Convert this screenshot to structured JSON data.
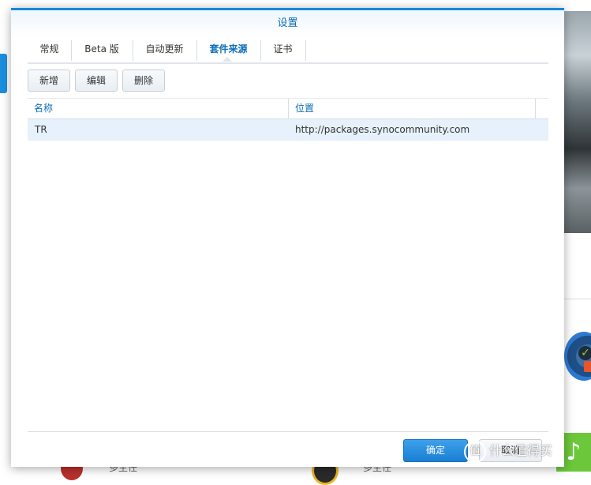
{
  "background": {
    "captions": [
      "多主任",
      "多主任"
    ],
    "green_tile_glyph": "♪"
  },
  "dialog": {
    "title": "设置",
    "tabs": [
      {
        "label": "常规"
      },
      {
        "label": "Beta 版"
      },
      {
        "label": "自动更新"
      },
      {
        "label": "套件来源",
        "active": true
      },
      {
        "label": "证书"
      }
    ],
    "toolbar": {
      "add_label": "新增",
      "edit_label": "编辑",
      "delete_label": "删除"
    },
    "table": {
      "columns": [
        "名称",
        "位置"
      ],
      "rows": [
        {
          "name": "TR",
          "location": "http://packages.synocommunity.com",
          "selected": true
        }
      ]
    },
    "footer": {
      "ok_label": "确定",
      "cancel_label": "取消"
    }
  },
  "watermark": {
    "text": "什么值得买",
    "icon": "值"
  },
  "colors": {
    "accent": "#1b87d8",
    "title_text": "#0d6eb8",
    "selected_row": "#e6f1fb"
  }
}
